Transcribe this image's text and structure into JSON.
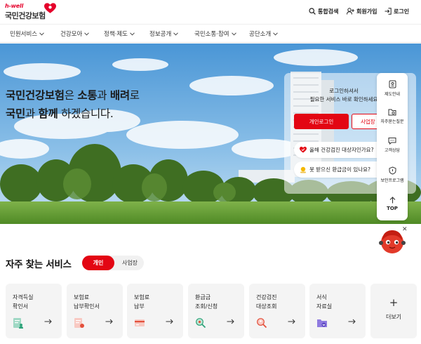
{
  "header": {
    "logo_sub": "h-well",
    "logo_main": "국민건강보험",
    "search_label": "통합검색",
    "join_label": "회원가입",
    "login_label": "로그인"
  },
  "nav": [
    "민원서비스",
    "건강모아",
    "정책·제도",
    "정보공개",
    "국민소통·참여",
    "공단소개"
  ],
  "hero": {
    "line1_a": "국민건강보험",
    "line1_b": "은 ",
    "line1_c": "소통",
    "line1_d": "과 ",
    "line1_e": "배려",
    "line1_f": "로",
    "line2_a": "국민",
    "line2_b": "과 ",
    "line2_c": "함께",
    "line2_d": " 하겠습니다."
  },
  "login_panel": {
    "msg1": "로그인하셔서",
    "msg2": "필요한 서비스 바로 확인하세요",
    "personal_login": "개인로그인",
    "biz_login": "사업장",
    "pill1": "올해 건강검진 대상자인가요?",
    "pill2": "못 받으신 환급금이 있나요?"
  },
  "quick_menu": {
    "items": [
      "제도안내",
      "자주묻는질문",
      "고객상담",
      "보안프로그램"
    ],
    "top": "TOP"
  },
  "services": {
    "title": "자주 찾는 서비스",
    "tab_personal": "개인",
    "tab_business": "사업장",
    "cards": [
      {
        "line1": "자격득실",
        "line2": "확인서",
        "icon": "doc-person-icon"
      },
      {
        "line1": "보험료",
        "line2": "납부확인서",
        "icon": "receipt-icon"
      },
      {
        "line1": "보험료",
        "line2": "납부",
        "icon": "payment-icon"
      },
      {
        "line1": "환급금",
        "line2": "조회/신청",
        "icon": "refund-search-icon"
      },
      {
        "line1": "건강검진",
        "line2": "대상조회",
        "icon": "checkup-search-icon"
      },
      {
        "line1": "서식",
        "line2": "자료실",
        "icon": "folder-download-icon"
      }
    ],
    "more_label": "더보기"
  },
  "colors": {
    "accent": "#e30613",
    "sky": "#4f9bd8",
    "grass": "#5a8f2e"
  }
}
